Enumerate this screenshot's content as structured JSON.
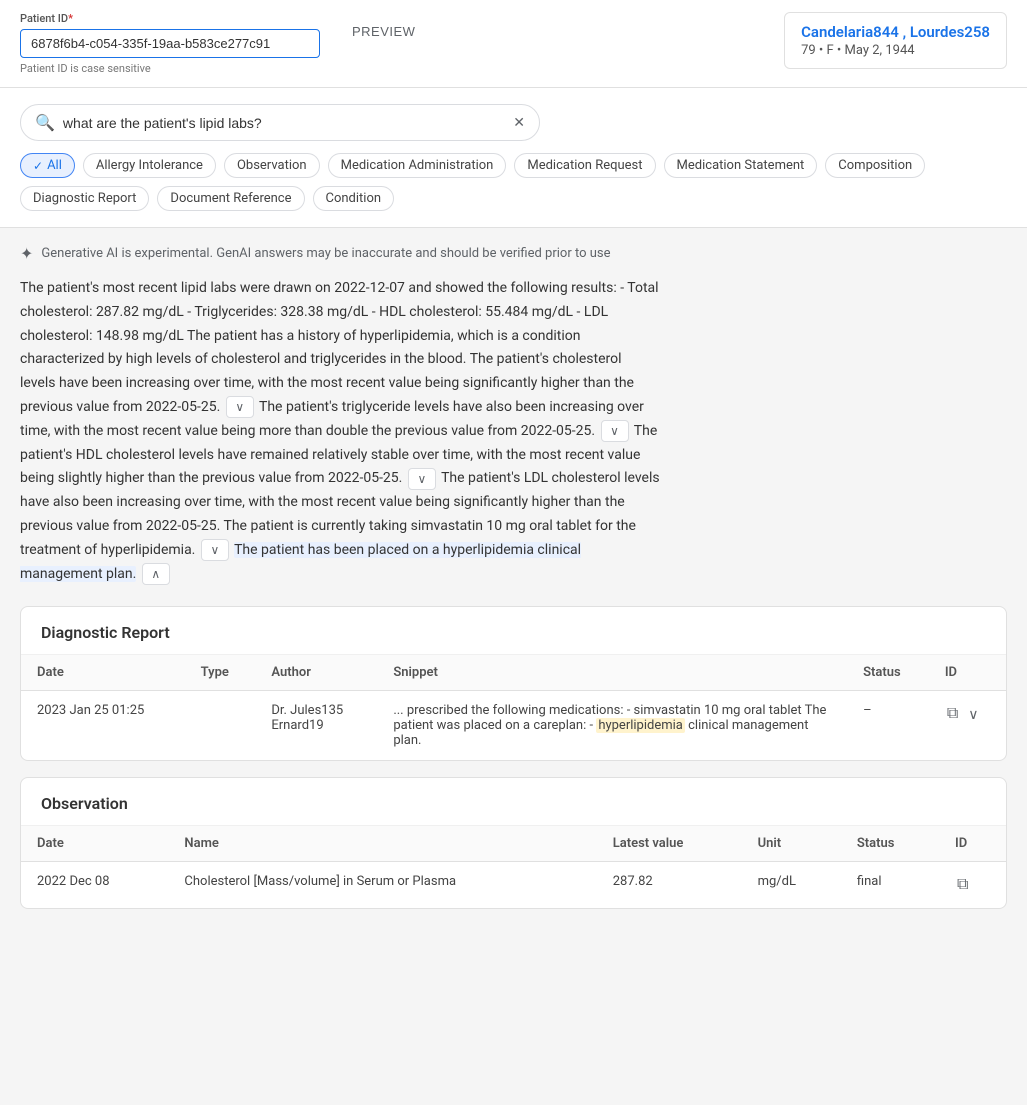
{
  "top_bar": {
    "patient_id_label": "Patient ID",
    "patient_id_required": "*",
    "patient_id_value": "6878f6b4-c054-335f-19aa-b583ce277c91",
    "patient_id_hint": "Patient ID is case sensitive",
    "preview_label": "PREVIEW",
    "patient_name": "Candelaria844 , Lourdes258",
    "patient_meta": "79 • F • May 2, 1944"
  },
  "search": {
    "placeholder": "what are the patient's lipid labs?",
    "value": "what are the patient's lipid labs?"
  },
  "filters": {
    "all": {
      "label": "All",
      "active": true
    },
    "allergy_intolerance": {
      "label": "Allergy Intolerance",
      "active": false
    },
    "observation": {
      "label": "Observation",
      "active": false
    },
    "medication_administration": {
      "label": "Medication Administration",
      "active": false
    },
    "medication_request": {
      "label": "Medication Request",
      "active": false
    },
    "medication_statement": {
      "label": "Medication Statement",
      "active": false
    },
    "composition": {
      "label": "Composition",
      "active": false
    },
    "diagnostic_report": {
      "label": "Diagnostic Report",
      "active": false
    },
    "document_reference": {
      "label": "Document Reference",
      "active": false
    },
    "condition": {
      "label": "Condition",
      "active": false
    }
  },
  "ai_disclaimer": "Generative AI is experimental. GenAI answers may be inaccurate and should be verified prior to use",
  "ai_response": {
    "text_part1": "The patient's most recent lipid labs were drawn on 2022-12-07 and showed the following results: - Total cholesterol: 287.82 mg/dL - Triglycerides: 328.38 mg/dL - HDL cholesterol: 55.484 mg/dL - LDL cholesterol: 148.98 mg/dL The patient has a history of hyperlipidemia, which is a condition characterized by high levels of cholesterol and triglycerides in the blood. The patient's cholesterol levels have been increasing over time, with the most recent value being significantly higher than the previous value from 2022-05-25.",
    "text_part2": "The patient's triglyceride levels have also been increasing over time, with the most recent value being more than double the previous value from 2022-05-25.",
    "text_part3": "The patient's HDL cholesterol levels have remained relatively stable over time, with the most recent value being slightly higher than the previous value from 2022-05-25.",
    "text_part4": "The patient's LDL cholesterol levels have also been increasing over time, with the most recent value being significantly higher than the previous value from 2022-05-25. The patient is currently taking simvastatin 10 mg oral tablet for the treatment of hyperlipidemia.",
    "text_highlighted": "The patient has been placed on a hyperlipidemia clinical management plan."
  },
  "diagnostic_report": {
    "title": "Diagnostic Report",
    "columns": [
      "Date",
      "Type",
      "Author",
      "Snippet",
      "Status",
      "ID"
    ],
    "rows": [
      {
        "date": "2023  Jan  25  01:25",
        "type": "",
        "author_line1": "Dr. Jules135",
        "author_line2": "Ernard19",
        "snippet_pre": "... prescribed the following medications: - simvastatin 10 mg oral tablet The patient was placed on a careplan: -",
        "snippet_highlight": "hyperlipidemia",
        "snippet_post": "clinical management plan.",
        "status": "–",
        "id": "copy"
      }
    ]
  },
  "observation": {
    "title": "Observation",
    "columns": [
      "Date",
      "Name",
      "Latest value",
      "Unit",
      "Status",
      "ID"
    ],
    "rows": [
      {
        "date": "2022  Dec  08",
        "name": "Cholesterol [Mass/volume] in Serum or Plasma",
        "latest_value": "287.82",
        "unit": "mg/dL",
        "status": "final",
        "id": "copy"
      }
    ]
  }
}
